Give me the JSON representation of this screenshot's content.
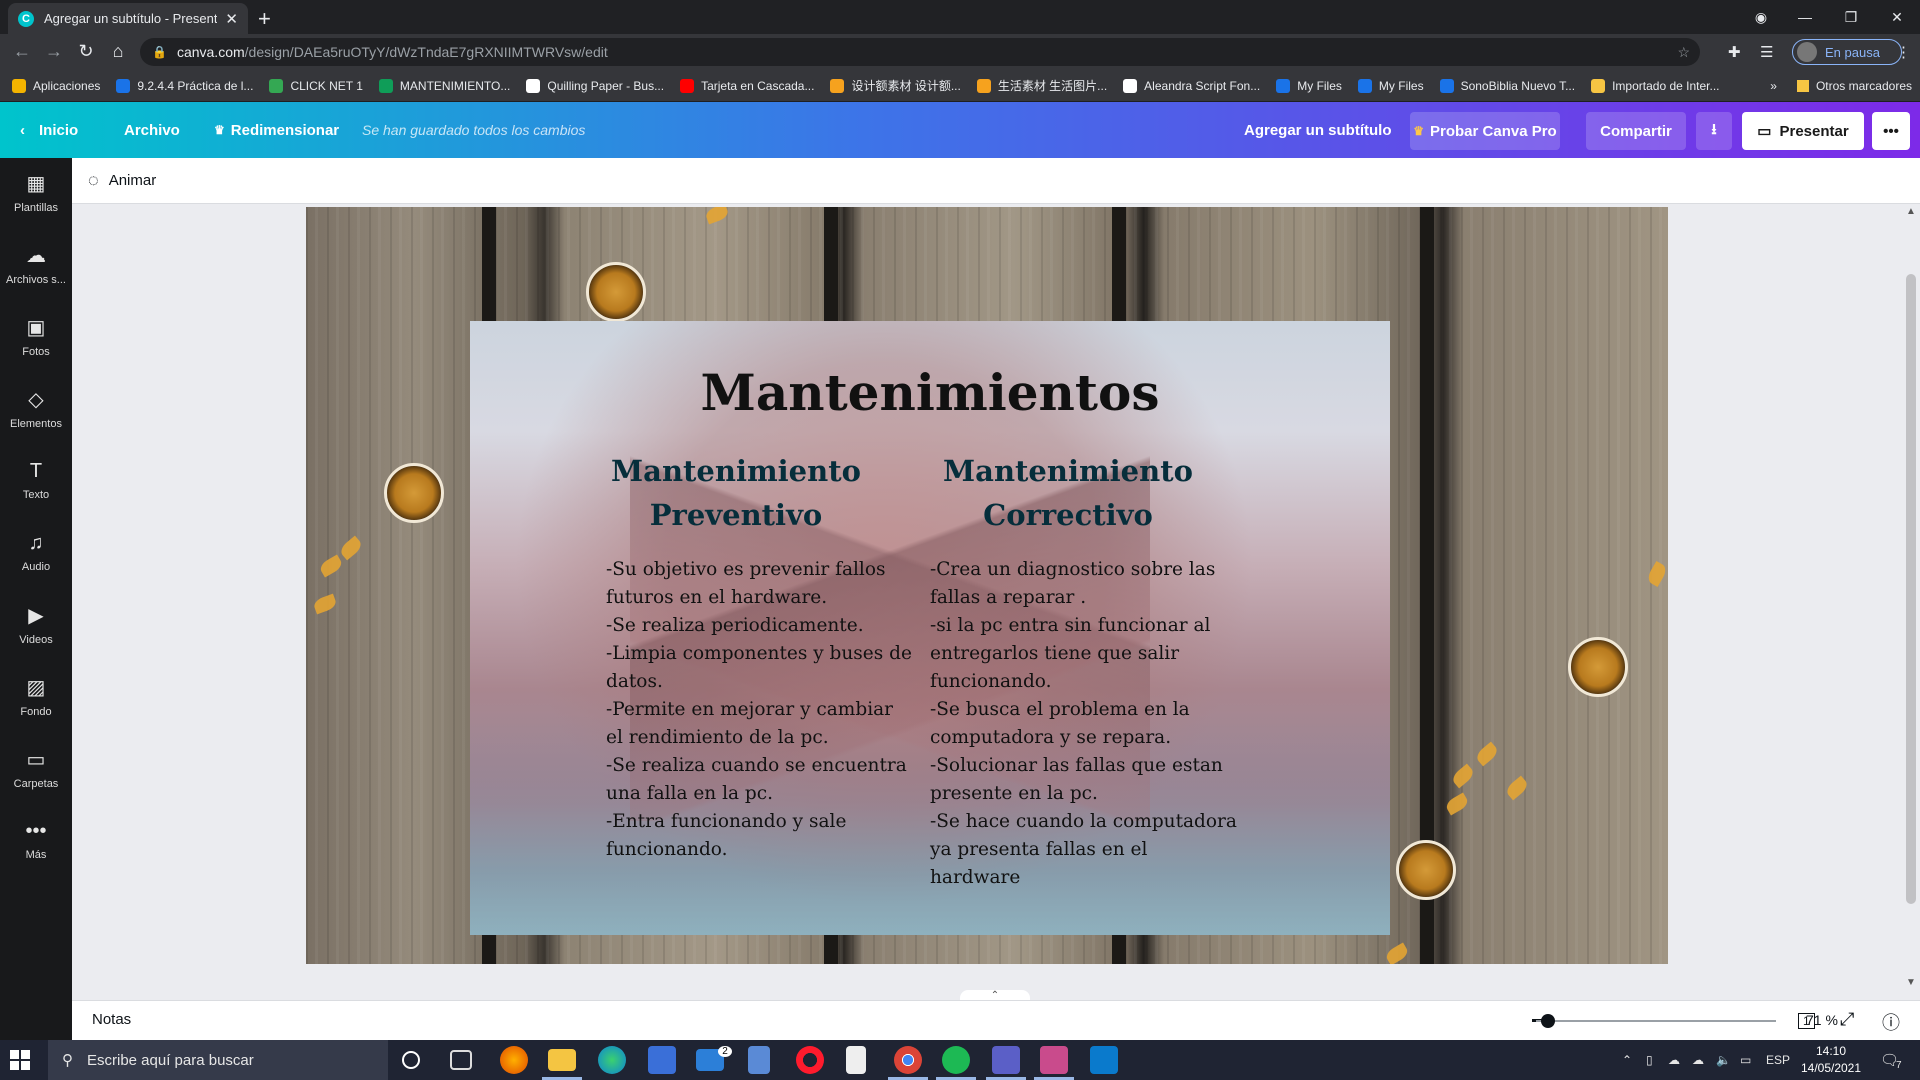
{
  "browser": {
    "tab_title": "Agregar un subtítulo - Presentac",
    "url_host": "canva.com",
    "url_path": "/design/DAEa5ruOTyY/dWzTndaE7gRXNIIMTWRVsw/edit",
    "profile_label": "En pausa"
  },
  "bookmarks": [
    {
      "label": "Aplicaciones",
      "color": "#f4b400"
    },
    {
      "label": "9.2.4.4 Práctica de l...",
      "color": "#1a73e8"
    },
    {
      "label": "CLICK NET 1",
      "color": "#34a853"
    },
    {
      "label": "MANTENIMIENTO...",
      "color": "#0f9d58"
    },
    {
      "label": "Quilling Paper - Bus...",
      "color": "#ffffff"
    },
    {
      "label": "Tarjeta en Cascada...",
      "color": "#ff0000"
    },
    {
      "label": "设计额素材 设计额...",
      "color": "#f6a21e"
    },
    {
      "label": "生活素材 生活图片...",
      "color": "#f6a21e"
    },
    {
      "label": "Aleandra Script Fon...",
      "color": "#ffffff"
    },
    {
      "label": "My Files",
      "color": "#1a73e8"
    },
    {
      "label": "My Files",
      "color": "#1a73e8"
    },
    {
      "label": "SonoBiblia Nuevo T...",
      "color": "#1a73e8"
    },
    {
      "label": "Importado de Inter...",
      "color": "#f6c543"
    }
  ],
  "bookmarks_other": "Otros marcadores",
  "canva_bar": {
    "home": "Inicio",
    "file": "Archivo",
    "resize": "Redimensionar",
    "saved_status": "Se han guardado todos los cambios",
    "doc_title": "Agregar un subtítulo",
    "try_pro": "Probar Canva Pro",
    "share": "Compartir",
    "present": "Presentar"
  },
  "sidebar": {
    "items": [
      {
        "label": "Plantillas",
        "icon": "templates-icon"
      },
      {
        "label": "Archivos s...",
        "icon": "upload-icon"
      },
      {
        "label": "Fotos",
        "icon": "photos-icon"
      },
      {
        "label": "Elementos",
        "icon": "elements-icon"
      },
      {
        "label": "Texto",
        "icon": "text-icon"
      },
      {
        "label": "Audio",
        "icon": "audio-icon"
      },
      {
        "label": "Videos",
        "icon": "video-icon"
      },
      {
        "label": "Fondo",
        "icon": "background-icon"
      },
      {
        "label": "Carpetas",
        "icon": "folder-icon"
      },
      {
        "label": "Más",
        "icon": "more-icon"
      }
    ]
  },
  "toolbar": {
    "animate": "Animar"
  },
  "slide": {
    "title": "Mantenimientos",
    "left": {
      "heading_1": "Mantenimiento",
      "heading_2": "Preventivo",
      "lines": [
        "-Su objetivo es prevenir fallos",
        "futuros en el hardware.",
        "-Se realiza periodicamente.",
        "-Limpia componentes y buses de",
        "datos.",
        "-Permite en mejorar y cambiar",
        "el rendimiento de la pc.",
        "-Se realiza cuando se encuentra",
        "una falla en la pc.",
        "-Entra funcionando y sale",
        "funcionando."
      ]
    },
    "right": {
      "heading_1": "Mantenimiento",
      "heading_2": "Correctivo",
      "lines": [
        "-Crea un diagnostico sobre las",
        "fallas a reparar .",
        "-si la pc entra sin funcionar al",
        "entregarlos tiene que salir",
        "funcionando.",
        "-Se busca el problema en la",
        "computadora y se repara.",
        "-Solucionar las fallas que estan",
        "presente en la pc.",
        "-Se hace cuando la computadora",
        "ya presenta fallas en el",
        "hardware"
      ]
    }
  },
  "notes_bar": {
    "notes": "Notas",
    "zoom": "71 %",
    "page": "1",
    "zoom_level_fraction": 0.05
  },
  "taskbar": {
    "search_placeholder": "Escribe aquí para buscar",
    "lang": "ESP",
    "time": "14:10",
    "date": "14/05/2021",
    "mail_badge": "2",
    "notif_badge": "7"
  }
}
